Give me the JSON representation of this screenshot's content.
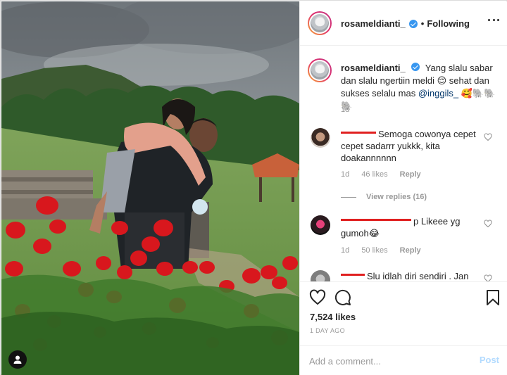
{
  "post": {
    "username": "rosameldianti_",
    "follow_status": "Following",
    "caption_username": "rosameldianti_",
    "caption_text": "Yang slalu sabar dan slalu ngertiin meldi 😌 sehat dan sukses selalu mas",
    "caption_mention": "@inggils_",
    "caption_emoji": "🥰🐘🐘🐘",
    "caption_time": "1d",
    "likes": "7,524 likes",
    "posted": "1 DAY AGO"
  },
  "comments": [
    {
      "text": "Semoga cowonya cepet cepet sadarrr yukkk, kita doakannnnnn",
      "time": "1d",
      "likes": "46 likes",
      "reply": "Reply",
      "view_replies": "View replies (16)"
    },
    {
      "text": "p Likeee yg gumoh😂",
      "time": "1d",
      "likes": "50 likes",
      "reply": "Reply"
    },
    {
      "text": "Slu idlah diri sendiri . Jan"
    }
  ],
  "composer": {
    "placeholder": "Add a comment...",
    "post_label": "Post"
  },
  "icons": {
    "like": "heart-icon",
    "comment": "comment-bubble-icon",
    "save": "bookmark-icon",
    "more": "more-options-icon",
    "verified": "verified-badge-icon",
    "tagged_user": "user-tag-icon"
  },
  "colors": {
    "accent": "#3897f0",
    "post_disabled": "#b3dbff",
    "muted": "#999999",
    "mention": "#003569",
    "redaction": "#e02020"
  }
}
